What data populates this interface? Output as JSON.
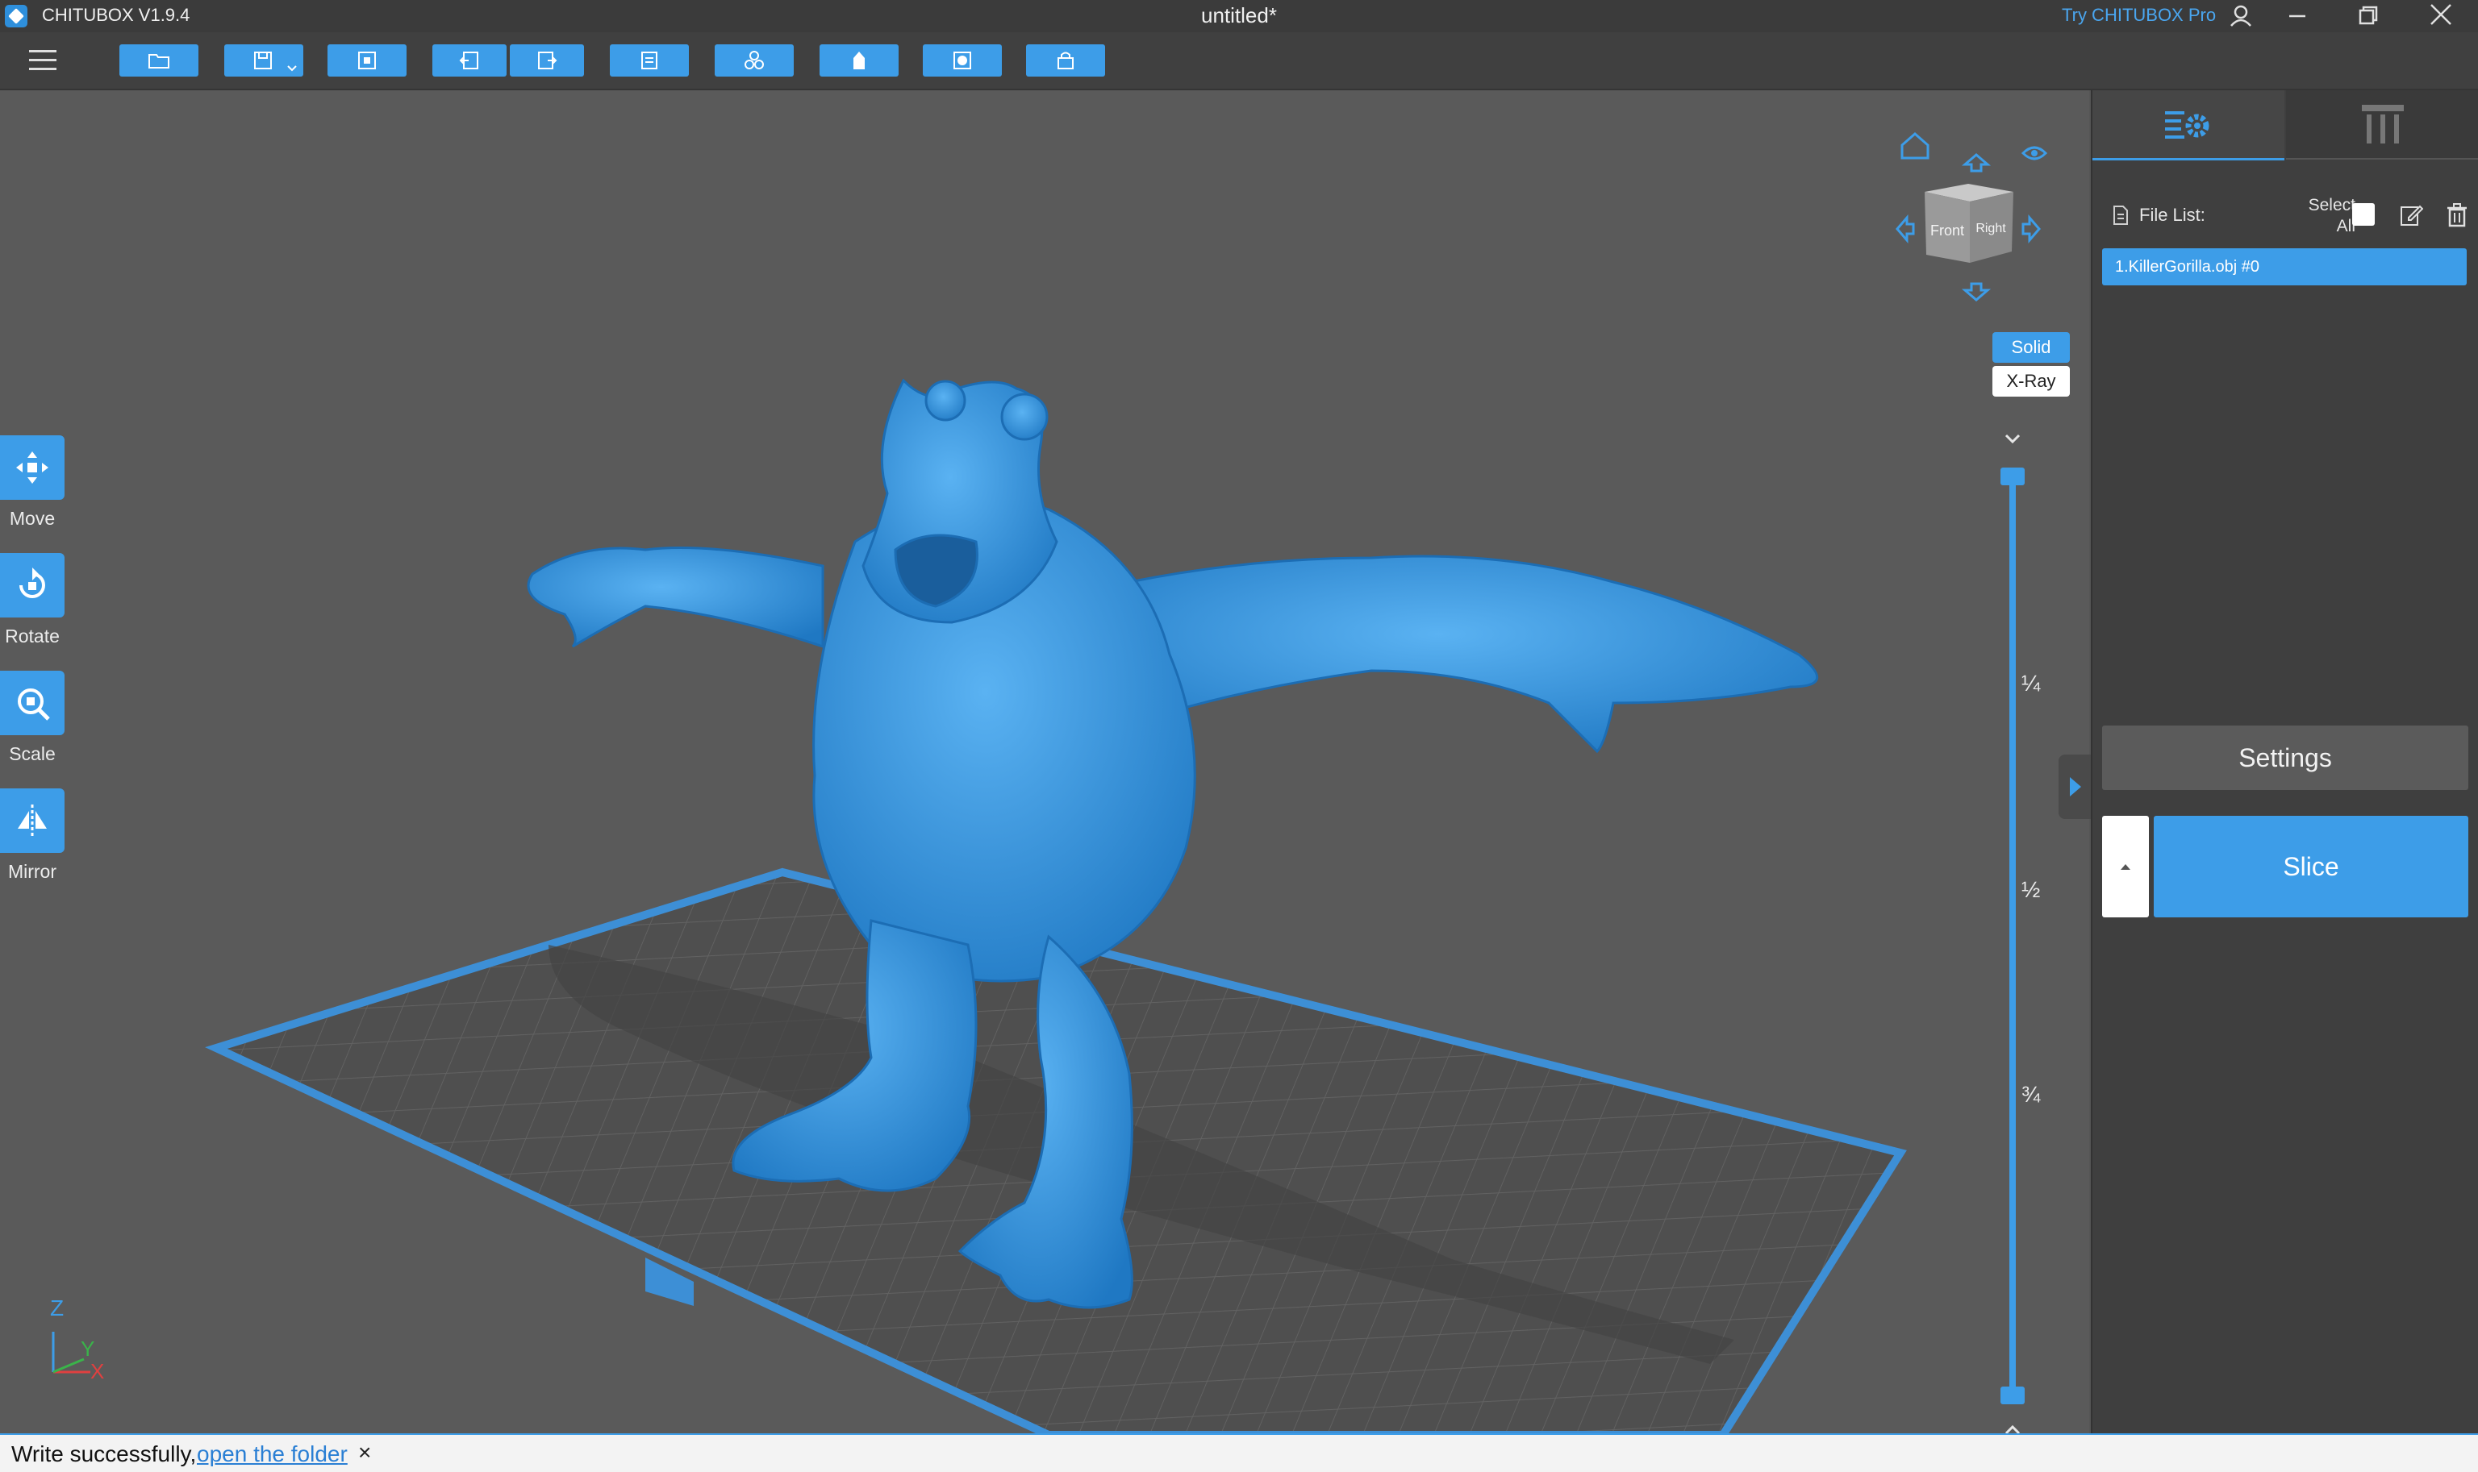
{
  "window": {
    "app_title": "CHITUBOX V1.9.4",
    "document_title": "untitled*",
    "try_pro": "Try CHITUBOX Pro"
  },
  "toolbar": {
    "items": [
      "open-file",
      "save",
      "auto-layout",
      "undo",
      "redo",
      "copy",
      "arrange",
      "hollow",
      "dig-hole",
      "lock"
    ]
  },
  "tools": {
    "move": "Move",
    "rotate": "Rotate",
    "scale": "Scale",
    "mirror": "Mirror"
  },
  "view": {
    "cube_front": "Front",
    "cube_right": "Right",
    "solid": "Solid",
    "xray": "X-Ray",
    "active_mode": "Solid"
  },
  "slider": {
    "marks": [
      "¼",
      "½",
      "¾"
    ]
  },
  "axes": {
    "z": "Z",
    "y": "Y",
    "x": "X"
  },
  "panel": {
    "file_list_label": "File List:",
    "select_all_line1": "Select",
    "select_all_line2": "All",
    "files": [
      "1.KillerGorilla.obj #0"
    ],
    "settings": "Settings",
    "slice": "Slice"
  },
  "status": {
    "message": "Write successfully,",
    "link": "open the folder",
    "close": "×"
  },
  "colors": {
    "accent": "#3d9de8",
    "model": "#3a93dd",
    "background": "#5a5a5a"
  }
}
